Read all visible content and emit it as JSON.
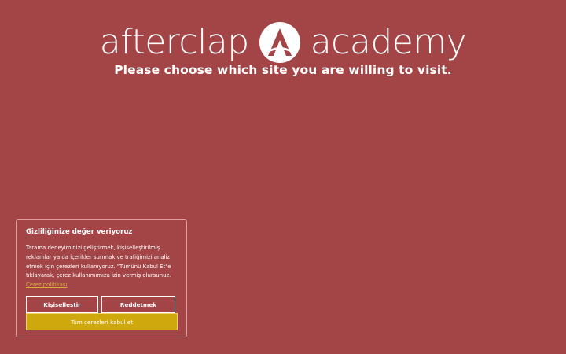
{
  "brand": {
    "word_left": "afterclap",
    "word_right": "academy",
    "logo_icon": "afterclap-logo-icon"
  },
  "headline": "Please choose which site you are willing to visit.",
  "cookie_banner": {
    "title": "Gizliliğinize değer veriyoruz",
    "body": "Tarama deneyiminizi geliştirmek, kişiselleştirilmiş reklamlar ya da içerikler sunmak ve trafiğimizi analiz etmek için çerezleri kullanıyoruz. \"Tümünü Kabul Et\"e tıklayarak, çerez kullanımımıza izin vermiş olursunuz.",
    "policy_link": "Çerez politikası",
    "customize_label": "Kişiselleştir",
    "reject_label": "Reddetmek",
    "accept_label": "Tüm çerezleri kabul et"
  },
  "colors": {
    "background": "#a34446",
    "accent": "#cfa80d",
    "link": "#d8b13a"
  }
}
